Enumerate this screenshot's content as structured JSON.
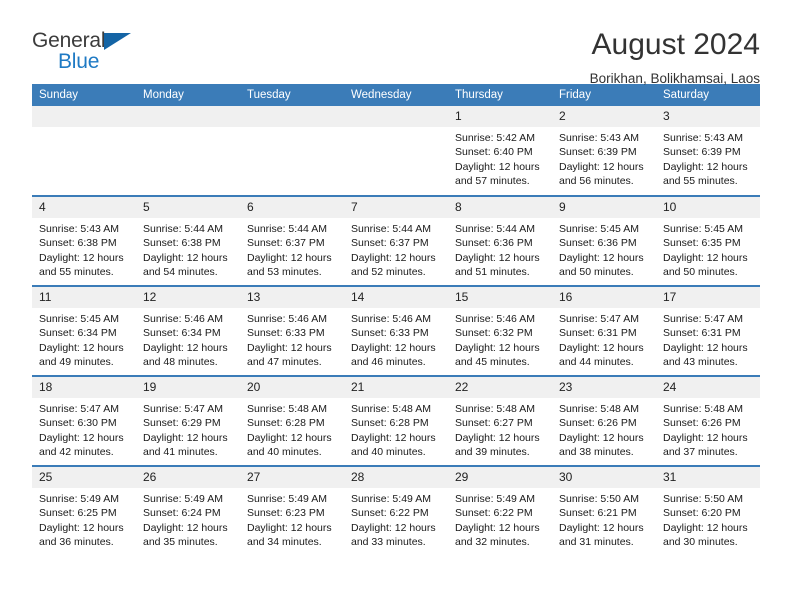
{
  "brand": {
    "line1": "General",
    "line2": "Blue",
    "triangle_icon": "blue-triangle-logo-mark",
    "color_dark": "#3c3c3c",
    "color_blue": "#1f7ac4"
  },
  "header": {
    "title": "August 2024",
    "subtitle": "Borikhan, Bolikhamsai, Laos"
  },
  "theme": {
    "header_bg": "#3b7cb8",
    "header_text": "#ffffff",
    "daynum_bg": "#f0f0f0",
    "row_divider": "#3b7cb8"
  },
  "weekday_headers": [
    "Sunday",
    "Monday",
    "Tuesday",
    "Wednesday",
    "Thursday",
    "Friday",
    "Saturday"
  ],
  "weeks": [
    [
      {
        "day": "",
        "empty": true,
        "sunrise": "",
        "sunset": "",
        "daylight1": "",
        "daylight2": ""
      },
      {
        "day": "",
        "empty": true,
        "sunrise": "",
        "sunset": "",
        "daylight1": "",
        "daylight2": ""
      },
      {
        "day": "",
        "empty": true,
        "sunrise": "",
        "sunset": "",
        "daylight1": "",
        "daylight2": ""
      },
      {
        "day": "",
        "empty": true,
        "sunrise": "",
        "sunset": "",
        "daylight1": "",
        "daylight2": ""
      },
      {
        "day": "1",
        "sunrise": "Sunrise: 5:42 AM",
        "sunset": "Sunset: 6:40 PM",
        "daylight1": "Daylight: 12 hours",
        "daylight2": "and 57 minutes."
      },
      {
        "day": "2",
        "sunrise": "Sunrise: 5:43 AM",
        "sunset": "Sunset: 6:39 PM",
        "daylight1": "Daylight: 12 hours",
        "daylight2": "and 56 minutes."
      },
      {
        "day": "3",
        "sunrise": "Sunrise: 5:43 AM",
        "sunset": "Sunset: 6:39 PM",
        "daylight1": "Daylight: 12 hours",
        "daylight2": "and 55 minutes."
      }
    ],
    [
      {
        "day": "4",
        "sunrise": "Sunrise: 5:43 AM",
        "sunset": "Sunset: 6:38 PM",
        "daylight1": "Daylight: 12 hours",
        "daylight2": "and 55 minutes."
      },
      {
        "day": "5",
        "sunrise": "Sunrise: 5:44 AM",
        "sunset": "Sunset: 6:38 PM",
        "daylight1": "Daylight: 12 hours",
        "daylight2": "and 54 minutes."
      },
      {
        "day": "6",
        "sunrise": "Sunrise: 5:44 AM",
        "sunset": "Sunset: 6:37 PM",
        "daylight1": "Daylight: 12 hours",
        "daylight2": "and 53 minutes."
      },
      {
        "day": "7",
        "sunrise": "Sunrise: 5:44 AM",
        "sunset": "Sunset: 6:37 PM",
        "daylight1": "Daylight: 12 hours",
        "daylight2": "and 52 minutes."
      },
      {
        "day": "8",
        "sunrise": "Sunrise: 5:44 AM",
        "sunset": "Sunset: 6:36 PM",
        "daylight1": "Daylight: 12 hours",
        "daylight2": "and 51 minutes."
      },
      {
        "day": "9",
        "sunrise": "Sunrise: 5:45 AM",
        "sunset": "Sunset: 6:36 PM",
        "daylight1": "Daylight: 12 hours",
        "daylight2": "and 50 minutes."
      },
      {
        "day": "10",
        "sunrise": "Sunrise: 5:45 AM",
        "sunset": "Sunset: 6:35 PM",
        "daylight1": "Daylight: 12 hours",
        "daylight2": "and 50 minutes."
      }
    ],
    [
      {
        "day": "11",
        "sunrise": "Sunrise: 5:45 AM",
        "sunset": "Sunset: 6:34 PM",
        "daylight1": "Daylight: 12 hours",
        "daylight2": "and 49 minutes."
      },
      {
        "day": "12",
        "sunrise": "Sunrise: 5:46 AM",
        "sunset": "Sunset: 6:34 PM",
        "daylight1": "Daylight: 12 hours",
        "daylight2": "and 48 minutes."
      },
      {
        "day": "13",
        "sunrise": "Sunrise: 5:46 AM",
        "sunset": "Sunset: 6:33 PM",
        "daylight1": "Daylight: 12 hours",
        "daylight2": "and 47 minutes."
      },
      {
        "day": "14",
        "sunrise": "Sunrise: 5:46 AM",
        "sunset": "Sunset: 6:33 PM",
        "daylight1": "Daylight: 12 hours",
        "daylight2": "and 46 minutes."
      },
      {
        "day": "15",
        "sunrise": "Sunrise: 5:46 AM",
        "sunset": "Sunset: 6:32 PM",
        "daylight1": "Daylight: 12 hours",
        "daylight2": "and 45 minutes."
      },
      {
        "day": "16",
        "sunrise": "Sunrise: 5:47 AM",
        "sunset": "Sunset: 6:31 PM",
        "daylight1": "Daylight: 12 hours",
        "daylight2": "and 44 minutes."
      },
      {
        "day": "17",
        "sunrise": "Sunrise: 5:47 AM",
        "sunset": "Sunset: 6:31 PM",
        "daylight1": "Daylight: 12 hours",
        "daylight2": "and 43 minutes."
      }
    ],
    [
      {
        "day": "18",
        "sunrise": "Sunrise: 5:47 AM",
        "sunset": "Sunset: 6:30 PM",
        "daylight1": "Daylight: 12 hours",
        "daylight2": "and 42 minutes."
      },
      {
        "day": "19",
        "sunrise": "Sunrise: 5:47 AM",
        "sunset": "Sunset: 6:29 PM",
        "daylight1": "Daylight: 12 hours",
        "daylight2": "and 41 minutes."
      },
      {
        "day": "20",
        "sunrise": "Sunrise: 5:48 AM",
        "sunset": "Sunset: 6:28 PM",
        "daylight1": "Daylight: 12 hours",
        "daylight2": "and 40 minutes."
      },
      {
        "day": "21",
        "sunrise": "Sunrise: 5:48 AM",
        "sunset": "Sunset: 6:28 PM",
        "daylight1": "Daylight: 12 hours",
        "daylight2": "and 40 minutes."
      },
      {
        "day": "22",
        "sunrise": "Sunrise: 5:48 AM",
        "sunset": "Sunset: 6:27 PM",
        "daylight1": "Daylight: 12 hours",
        "daylight2": "and 39 minutes."
      },
      {
        "day": "23",
        "sunrise": "Sunrise: 5:48 AM",
        "sunset": "Sunset: 6:26 PM",
        "daylight1": "Daylight: 12 hours",
        "daylight2": "and 38 minutes."
      },
      {
        "day": "24",
        "sunrise": "Sunrise: 5:48 AM",
        "sunset": "Sunset: 6:26 PM",
        "daylight1": "Daylight: 12 hours",
        "daylight2": "and 37 minutes."
      }
    ],
    [
      {
        "day": "25",
        "sunrise": "Sunrise: 5:49 AM",
        "sunset": "Sunset: 6:25 PM",
        "daylight1": "Daylight: 12 hours",
        "daylight2": "and 36 minutes."
      },
      {
        "day": "26",
        "sunrise": "Sunrise: 5:49 AM",
        "sunset": "Sunset: 6:24 PM",
        "daylight1": "Daylight: 12 hours",
        "daylight2": "and 35 minutes."
      },
      {
        "day": "27",
        "sunrise": "Sunrise: 5:49 AM",
        "sunset": "Sunset: 6:23 PM",
        "daylight1": "Daylight: 12 hours",
        "daylight2": "and 34 minutes."
      },
      {
        "day": "28",
        "sunrise": "Sunrise: 5:49 AM",
        "sunset": "Sunset: 6:22 PM",
        "daylight1": "Daylight: 12 hours",
        "daylight2": "and 33 minutes."
      },
      {
        "day": "29",
        "sunrise": "Sunrise: 5:49 AM",
        "sunset": "Sunset: 6:22 PM",
        "daylight1": "Daylight: 12 hours",
        "daylight2": "and 32 minutes."
      },
      {
        "day": "30",
        "sunrise": "Sunrise: 5:50 AM",
        "sunset": "Sunset: 6:21 PM",
        "daylight1": "Daylight: 12 hours",
        "daylight2": "and 31 minutes."
      },
      {
        "day": "31",
        "sunrise": "Sunrise: 5:50 AM",
        "sunset": "Sunset: 6:20 PM",
        "daylight1": "Daylight: 12 hours",
        "daylight2": "and 30 minutes."
      }
    ]
  ]
}
